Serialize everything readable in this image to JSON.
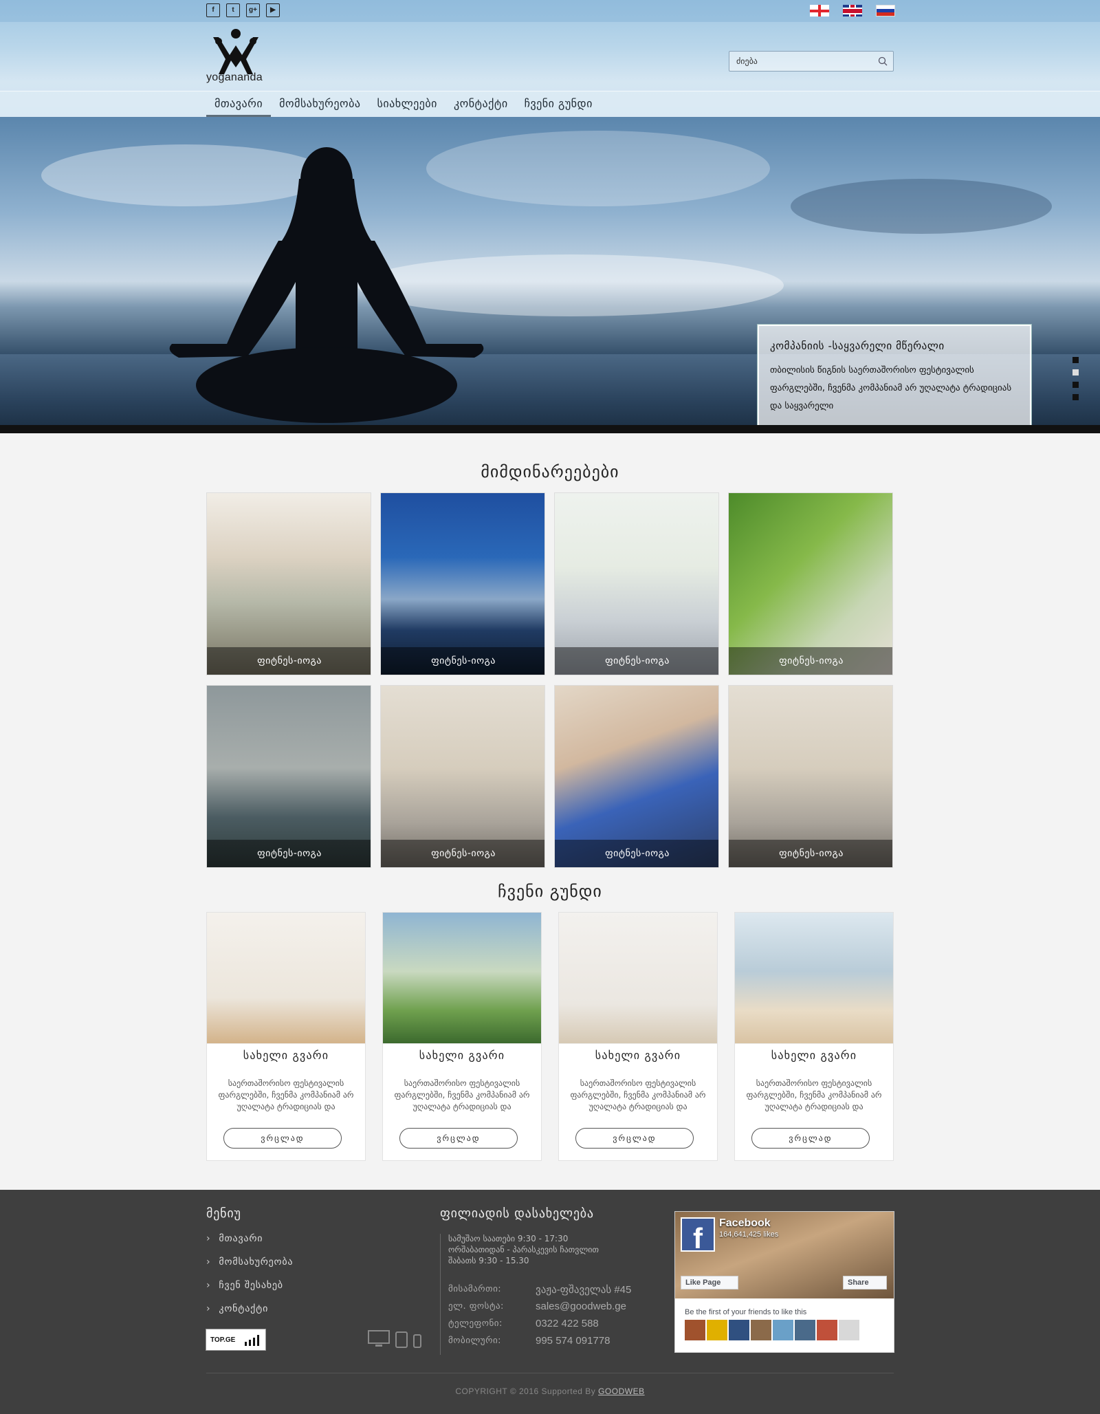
{
  "header": {
    "social_icons": [
      "facebook-icon",
      "twitter-icon",
      "google-plus-icon",
      "youtube-icon"
    ],
    "social_glyphs": [
      "f",
      "t",
      "g+",
      "▶"
    ],
    "languages": [
      "georgian",
      "english",
      "russian"
    ],
    "logo_text": "yogananda",
    "search_placeholder": "ძიება"
  },
  "nav": {
    "items": [
      "მთავარი",
      "მომსახურეობა",
      "სიახლეები",
      "კონტაქტი",
      "ჩვენი გუნდი"
    ],
    "active_index": 0
  },
  "hero": {
    "title": "კომპანიის -საყვარელი მწერალი",
    "text": "თბილისის წიგნის საერთაშორისო ფესტივალის ფარგლებში, ჩვენმა კომპანიამ არ უღალატა ტრადიციას და საყვარელი",
    "slides_count": 4,
    "active_slide": 1
  },
  "events": {
    "title": "მიმდინარეებები",
    "items": [
      {
        "caption": "ფიტნეს-იოგა"
      },
      {
        "caption": "ფიტნეს-იოგა"
      },
      {
        "caption": "ფიტნეს-იოგა"
      },
      {
        "caption": "ფიტნეს-იოგა"
      },
      {
        "caption": "ფიტნეს-იოგა"
      },
      {
        "caption": "ფიტნეს-იოგა"
      },
      {
        "caption": "ფიტნეს-იოგა"
      },
      {
        "caption": "ფიტნეს-იოგა"
      }
    ]
  },
  "team": {
    "title": "ჩვენი გუნდი",
    "members": [
      {
        "name": "სახელი გვარი",
        "desc": "საერთაშორისო ფესტივალის ფარგლებში, ჩვენმა კომპანიამ არ უღალატა ტრადიციას და",
        "button": "ვრცლად"
      },
      {
        "name": "სახელი გვარი",
        "desc": "საერთაშორისო ფესტივალის ფარგლებში, ჩვენმა კომპანიამ არ უღალატა ტრადიციას და",
        "button": "ვრცლად"
      },
      {
        "name": "სახელი გვარი",
        "desc": "საერთაშორისო ფესტივალის ფარგლებში, ჩვენმა კომპანიამ არ უღალატა ტრადიციას და",
        "button": "ვრცლად"
      },
      {
        "name": "სახელი გვარი",
        "desc": "საერთაშორისო ფესტივალის ფარგლებში, ჩვენმა კომპანიამ არ უღალატა ტრადიციას და",
        "button": "ვრცლად"
      }
    ]
  },
  "footer": {
    "menu_title": "მენიუ",
    "menu_items": [
      "მთავარი",
      "მომსახურეობა",
      "ჩვენ შესახებ",
      "კონტაქტი"
    ],
    "topge_label": "TOP.GE",
    "branch_title": "ფილიადის დასახელება",
    "hours": [
      "სამუშაო საათები  9:30 - 17:30",
      "ორშაბათიდან - პარასკევის ჩათვლით",
      "შაბათს  9:30 - 15.30"
    ],
    "contacts": [
      {
        "label": "მისამართი:",
        "value": "ვაჟა-ფშაველას #45"
      },
      {
        "label": "ელ. ფოსტა:",
        "value": "sales@goodweb.ge"
      },
      {
        "label": "ტელეფონი:",
        "value": "0322 422 588"
      },
      {
        "label": "მობილური:",
        "value": "995 574 091778"
      }
    ],
    "facebook": {
      "page_name": "Facebook",
      "likes": "164,641,425 likes",
      "like_button": "Like Page",
      "share_button": "Share",
      "friends_text": "Be the first of your friends to like this"
    },
    "copyright_text": "COPYRIGHT © 2016 Supported By",
    "copyright_link": "GOODWEB"
  }
}
